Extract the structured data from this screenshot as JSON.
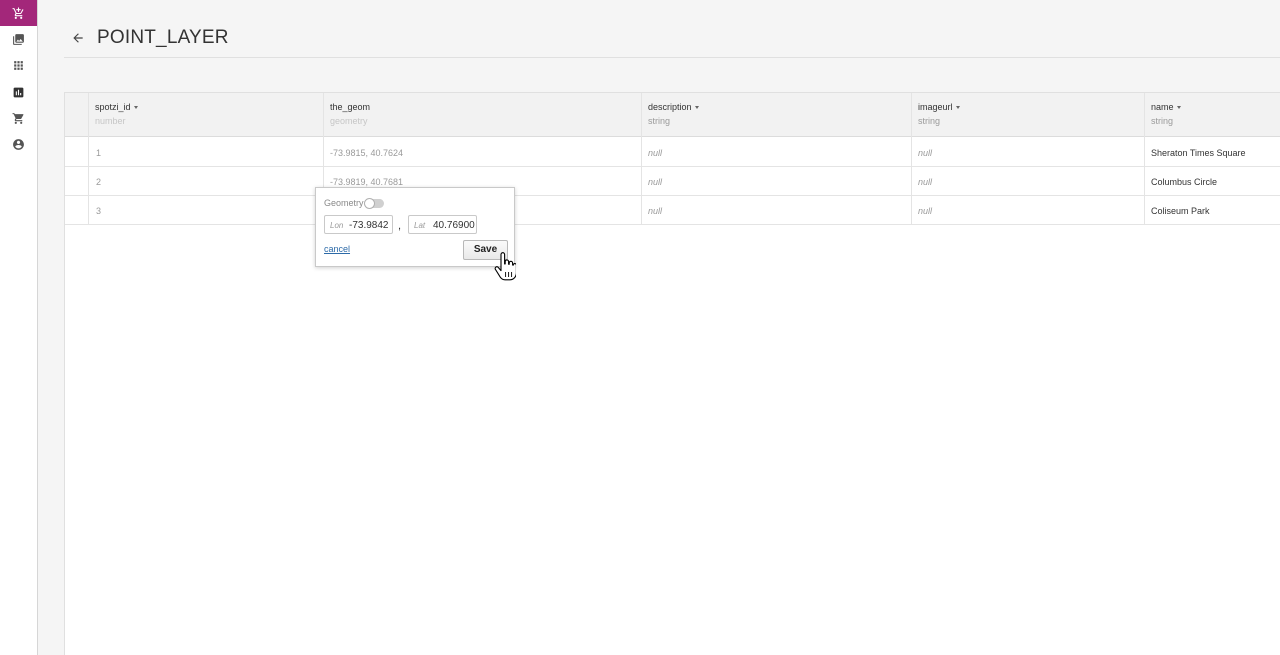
{
  "sidebar": {
    "items": [
      {
        "icon": "cart-add-icon",
        "active": true
      },
      {
        "icon": "images-icon",
        "active": false
      },
      {
        "icon": "apps-grid-icon",
        "active": false
      },
      {
        "icon": "bar-chart-icon",
        "active": false
      },
      {
        "icon": "cart-icon",
        "active": false
      },
      {
        "icon": "account-icon",
        "active": false
      }
    ],
    "active_color": "#a3277a"
  },
  "header": {
    "title": "POINT_LAYER",
    "back_icon": "arrow-left-icon"
  },
  "table": {
    "columns": [
      {
        "name": "spotzi_id",
        "type": "number",
        "sortable": true
      },
      {
        "name": "the_geom",
        "type": "geometry",
        "sortable": false
      },
      {
        "name": "description",
        "type": "string",
        "sortable": true
      },
      {
        "name": "imageurl",
        "type": "string",
        "sortable": true
      },
      {
        "name": "name",
        "type": "string",
        "sortable": true
      }
    ],
    "rows": [
      {
        "spotzi_id": "1",
        "the_geom": "-73.9815, 40.7624",
        "description": "null",
        "imageurl": "null",
        "name": "Sheraton Times Square"
      },
      {
        "spotzi_id": "2",
        "the_geom": "-73.9819, 40.7681",
        "description": "null",
        "imageurl": "null",
        "name": "Columbus Circle"
      },
      {
        "spotzi_id": "3",
        "the_geom": "",
        "description": "null",
        "imageurl": "null",
        "name": "Coliseum Park"
      }
    ]
  },
  "editor": {
    "geometry_label": "Geometry",
    "geometry_toggle_on": false,
    "lon_label": "Lon",
    "lon_value": "-73.9842",
    "separator": ",",
    "lat_label": "Lat",
    "lat_value": "40.76900",
    "cancel_label": "cancel",
    "save_label": "Save"
  }
}
